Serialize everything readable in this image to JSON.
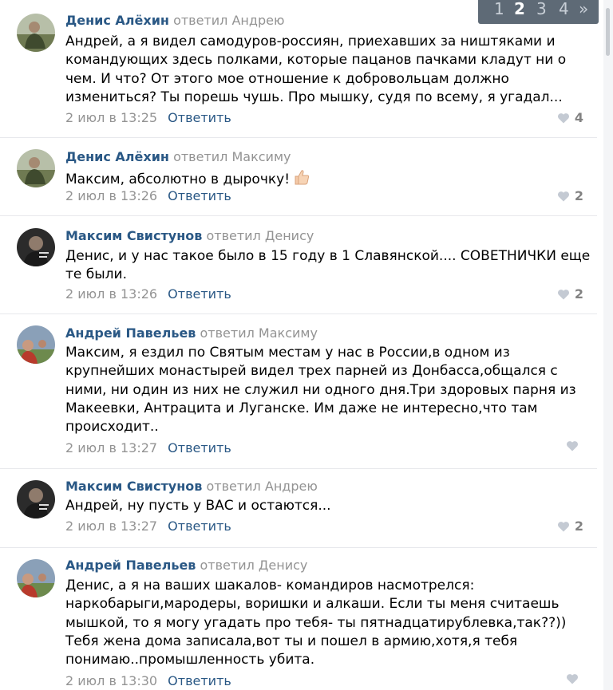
{
  "comments": [
    {
      "author": "Денис Алёхин",
      "reply_to": "ответил Андрею",
      "text": "Андрей, а я видел самодуров-россиян, приехавших за ништяками и командующих здесь полками, которые пацанов пачками кладут ни о чем. И что? От этого мое отношение к добровольцам должно измениться? Ты порешь чушь. Про мышку, судя по всему, я угадал...",
      "date": "2 июл в 13:25",
      "reply_label": "Ответить",
      "likes": "4"
    },
    {
      "author": "Денис Алёхин",
      "reply_to": "ответил Максиму",
      "text": "Максим, абсолютно в дырочку!",
      "date": "2 июл в 13:26",
      "reply_label": "Ответить",
      "likes": "2"
    },
    {
      "author": "Максим Свистунов",
      "reply_to": "ответил Денису",
      "text": "Денис, и у нас такое было в 15 году в 1 Славянской.... СОВЕТНИЧКИ еще те были.",
      "date": "2 июл в 13:26",
      "reply_label": "Ответить",
      "likes": "2"
    },
    {
      "author": "Андрей Павельев",
      "reply_to": "ответил Максиму",
      "text": "Максим, я ездил по Святым местам у нас в России,в одном из крупнейших монастырей видел трех парней из Донбасса,общался с ними, ни один из них не служил ни одного дня.Три здоровых парня из Макеевки, Антрацита и Луганске. Им даже не интересно,что там происходит..",
      "date": "2 июл в 13:27",
      "reply_label": "Ответить",
      "likes": ""
    },
    {
      "author": "Максим Свистунов",
      "reply_to": "ответил Андрею",
      "text": "Андрей, ну пусть у ВАС и остаются...",
      "date": "2 июл в 13:27",
      "reply_label": "Ответить",
      "likes": "2"
    },
    {
      "author": "Андрей Павельев",
      "reply_to": "ответил Денису",
      "text": "Денис, а я на ваших шакалов- командиров насмотрелся: наркобарыги,мародеры, воришки и алкаши. Если ты меня считаешь мышкой, то я могу угадать про тебя- ты пятнадцатирублевка,так??)) Тебя жена дома записала,вот ты и пошел в армию,хотя,я тебя понимаю..промышленность убита.",
      "date": "2 июл в 13:30",
      "reply_label": "Ответить",
      "likes": ""
    }
  ],
  "pager": {
    "pages": [
      "1",
      "2",
      "3",
      "4"
    ],
    "current": "2",
    "next": "»"
  },
  "colors": {
    "author": "#2a5885",
    "muted": "#939393",
    "pager_bg": "#5e6a76",
    "divider": "#e7e8ec"
  }
}
